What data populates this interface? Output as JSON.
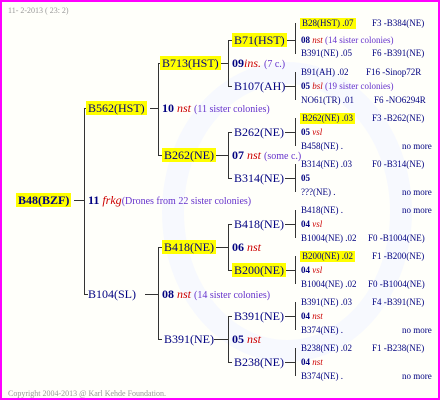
{
  "header": "11- 2-2013 ( 23: 2)",
  "footer": "Copyright 2004-2013 @ Karl Kehde Foundation.",
  "root": {
    "code": "B48(BZF)",
    "gen": "11",
    "name": "frkg",
    "note": "(Drones from 22 sister colonies)"
  },
  "gen1": [
    {
      "code": "B562(HST)",
      "gen": "10",
      "name": "nst",
      "note": "(11 sister colonies)"
    },
    {
      "code": "B104(SL)",
      "gen": "08",
      "name": "nst",
      "note": "(14 sister colonies)"
    }
  ],
  "gen2": [
    {
      "code": "B713(HST)",
      "gen": "09",
      "name": "ins.",
      "note": "(7 c.)"
    },
    {
      "code": "B262(NE)",
      "gen": "07",
      "name": "nst",
      "note": "(some c.)"
    },
    {
      "code": "B418(NE)",
      "gen": "06",
      "name": "nst",
      "note": ""
    },
    {
      "code": "B391(NE)",
      "gen": "05",
      "name": "nst",
      "note": ""
    }
  ],
  "gen3": [
    {
      "code": "B71(HST)",
      "gen": "08",
      "name": "nst",
      "note": "(14 sister colonies)"
    },
    {
      "code": "B107(AH)",
      "gen": "05",
      "name": "bsl",
      "note": "(19 sister colonies)"
    },
    {
      "code": "B262(NE)",
      "gen": "05",
      "name": "vsl",
      "note": ""
    },
    {
      "code": "B314(NE)",
      "gen": "05",
      "name": "",
      "note": ""
    },
    {
      "code": "B418(NE)",
      "gen": "04",
      "name": "vsl",
      "note": ""
    },
    {
      "code": "B200(NE)",
      "gen": "04",
      "name": "vsl",
      "note": ""
    },
    {
      "code": "B391(NE)",
      "gen": "04",
      "name": "nst",
      "note": ""
    },
    {
      "code": "B238(NE)",
      "gen": "04",
      "name": "nst",
      "note": ""
    }
  ],
  "gen4": [
    {
      "left": "B28(HST) .07",
      "right": "F3 -B384(NE)"
    },
    {
      "left": "B391(NE) .05",
      "right": "F6 -B391(NE)"
    },
    {
      "left": "B91(AH) .02",
      "right": "F16 -Sinop72R"
    },
    {
      "left": "NO61(TR) .01",
      "right": "F6 -NO6294R"
    },
    {
      "left": "B262(NE) .03",
      "right": "F3 -B262(NE)"
    },
    {
      "left": "B458(NE) .",
      "right": "no more"
    },
    {
      "left": "B314(NE) .03",
      "right": "F0 -B314(NE)"
    },
    {
      "left": "???(NE) .",
      "right": "no more"
    },
    {
      "left": "B418(NE) .",
      "right": "no more"
    },
    {
      "left": "B1004(NE) .02",
      "right": "F0 -B1004(NE)"
    },
    {
      "left": "B200(NE) .02",
      "right": "F1 -B200(NE)"
    },
    {
      "left": "B1004(NE) .02",
      "right": "F0 -B1004(NE)"
    },
    {
      "left": "B391(NE) .03",
      "right": "F4 -B391(NE)"
    },
    {
      "left": "B374(NE) .",
      "right": "no more"
    },
    {
      "left": "B238(NE) .02",
      "right": "F1 -B238(NE)"
    },
    {
      "left": "B374(NE) .",
      "right": "no more"
    }
  ]
}
